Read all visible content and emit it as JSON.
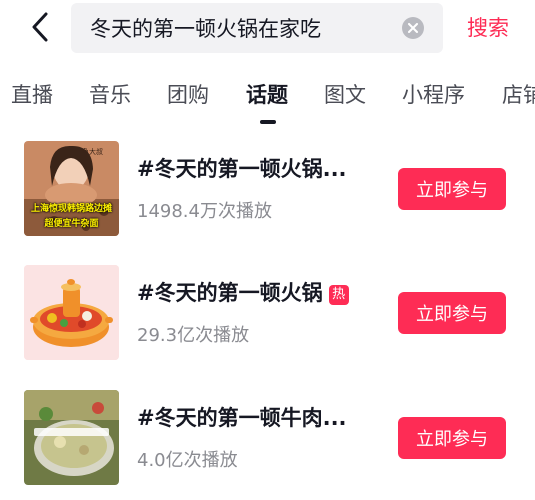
{
  "search": {
    "query": "冬天的第一顿火锅在家吃",
    "button_label": "搜索"
  },
  "tabs": [
    {
      "label": "直播"
    },
    {
      "label": "音乐"
    },
    {
      "label": "团购"
    },
    {
      "label": "话题",
      "active": true
    },
    {
      "label": "图文"
    },
    {
      "label": "小程序"
    },
    {
      "label": "店铺"
    }
  ],
  "results": [
    {
      "title": "#冬天的第一顿火锅...",
      "plays": "1498.4万次播放",
      "join_label": "立即参与",
      "thumb_caption_line1": "上海惊现韩锅路边摊",
      "thumb_caption_line2": "超便宜牛杂面",
      "thumb_tag": "鱼大叔"
    },
    {
      "title": "#冬天的第一顿火锅",
      "hot_badge": "热",
      "plays": "29.3亿次播放",
      "join_label": "立即参与"
    },
    {
      "title": "#冬天的第一顿牛肉...",
      "plays": "4.0亿次播放",
      "join_label": "立即参与"
    }
  ],
  "colors": {
    "accent": "#fe2c55",
    "text_primary": "#161823",
    "text_secondary": "#8a8b91",
    "search_bg": "#f2f2f4"
  }
}
